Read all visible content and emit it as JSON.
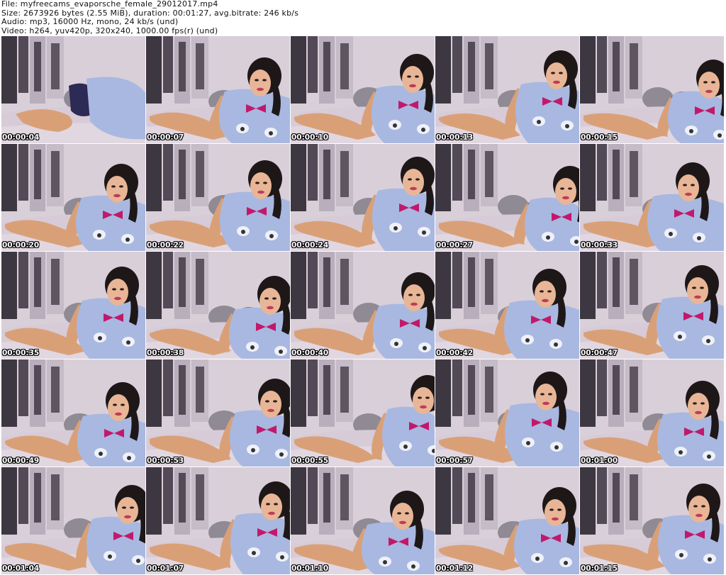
{
  "header": {
    "file_line": "File: myfreecams_evaporsche_female_29012017.mp4",
    "size_line": "Size: 2673926 bytes (2.55 MiB), duration: 00:01:27, avg.bitrate: 246 kb/s",
    "audio_line": "Audio: mp3, 16000 Hz, mono, 24 kb/s (und)",
    "video_line": "Video: h264, yuv420p, 320x240, 1000.00 fps(r) (und)"
  },
  "thumbnails": [
    {
      "timestamp": "00:00:04"
    },
    {
      "timestamp": "00:00:07"
    },
    {
      "timestamp": "00:00:10"
    },
    {
      "timestamp": "00:00:13"
    },
    {
      "timestamp": "00:00:15"
    },
    {
      "timestamp": "00:00:20"
    },
    {
      "timestamp": "00:00:22"
    },
    {
      "timestamp": "00:00:24"
    },
    {
      "timestamp": "00:00:27"
    },
    {
      "timestamp": "00:00:33"
    },
    {
      "timestamp": "00:00:35"
    },
    {
      "timestamp": "00:00:38"
    },
    {
      "timestamp": "00:00:40"
    },
    {
      "timestamp": "00:00:42"
    },
    {
      "timestamp": "00:00:47"
    },
    {
      "timestamp": "00:00:49"
    },
    {
      "timestamp": "00:00:53"
    },
    {
      "timestamp": "00:00:55"
    },
    {
      "timestamp": "00:00:57"
    },
    {
      "timestamp": "00:01:00"
    },
    {
      "timestamp": "00:01:04"
    },
    {
      "timestamp": "00:01:07"
    },
    {
      "timestamp": "00:01:10"
    },
    {
      "timestamp": "00:01:12"
    },
    {
      "timestamp": "00:01:15"
    }
  ],
  "colors": {
    "wall": "#d9cfd9",
    "bed": "#d7cbd7",
    "curtain": "#2b2630",
    "shirt": "#a9b8e0",
    "bow": "#c2186b",
    "skin": "#d9a078",
    "hair": "#1e1718"
  }
}
